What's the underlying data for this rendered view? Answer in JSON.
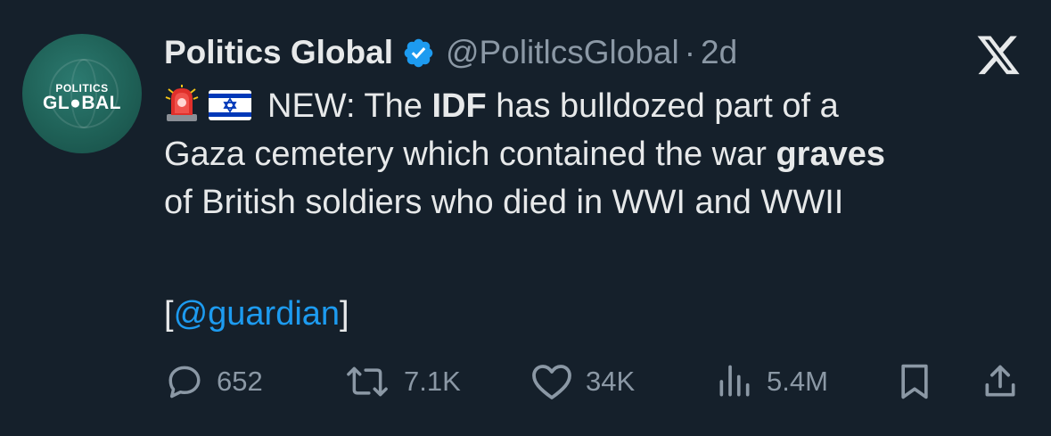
{
  "account": {
    "avatar_text_top": "POLITICS",
    "avatar_text_bottom": "GL●BAL",
    "display_name": "Politics Global",
    "handle": "@PolitlcsGlobal",
    "separator": "·",
    "time": "2d",
    "verified": true
  },
  "platform_logo": "x-logo-icon",
  "tweet": {
    "emoji_1": "police-car-light-icon",
    "emoji_2": "israel-flag-icon",
    "line1_a": "NEW: The ",
    "line1_bold": "IDF",
    "line1_b": " has bulldozed part of a",
    "line2_a": "Gaza cemetery which contained the war ",
    "line2_bold": "graves",
    "line3": "of British soldiers who died in WWI and WWII",
    "mention_open": "[",
    "mention": "@guardian",
    "mention_close": "]"
  },
  "actions": {
    "replies": "652",
    "reposts": "7.1K",
    "likes": "34K",
    "views": "5.4M"
  },
  "colors": {
    "background": "#15202b",
    "text": "#e7e9ea",
    "secondary": "#8b98a5",
    "accent": "#1d9bf0",
    "verified": "#1d9bf0"
  }
}
